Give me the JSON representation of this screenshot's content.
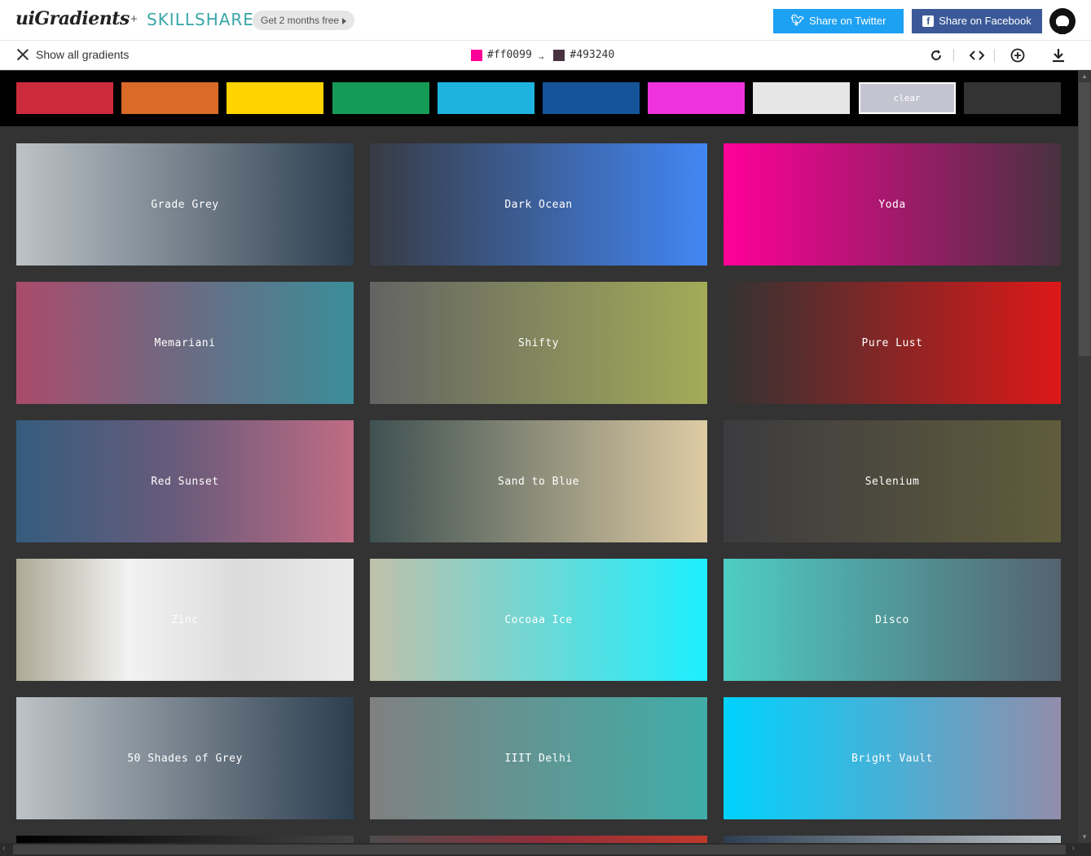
{
  "header": {
    "logo": "uiGradients",
    "plus": "+",
    "partner": "SKILLSHARE",
    "promo": "Get 2 months free",
    "share_twitter": "Share on Twitter",
    "share_facebook": "Share on Facebook",
    "icons": {
      "twitter": "twitter-icon",
      "facebook": "facebook-icon",
      "github": "github-icon"
    }
  },
  "infobar": {
    "close_label": "Show all gradients",
    "color_from": "#ff0099",
    "arrow": "→",
    "color_to": "#493240",
    "tools": [
      "rotate-icon",
      "code-icon",
      "add-icon",
      "download-icon"
    ]
  },
  "filters": [
    {
      "color": "#cc2b3c"
    },
    {
      "color": "#d96a27"
    },
    {
      "color": "#ffd300"
    },
    {
      "color": "#169b56"
    },
    {
      "color": "#1eb3de"
    },
    {
      "color": "#16549a"
    },
    {
      "color": "#ee33dd"
    },
    {
      "color": "#e6e6e6"
    },
    {
      "color": "#c4c4d1",
      "label": "clear"
    },
    {
      "color": "#333333"
    }
  ],
  "gradients": [
    {
      "name": "Grade Grey",
      "from": "#bdc3c7",
      "to": "#2c3e50"
    },
    {
      "name": "Dark Ocean",
      "from": "#373b44",
      "to": "#4286f4"
    },
    {
      "name": "Yoda",
      "from": "#ff0099",
      "to": "#493240"
    },
    {
      "name": "Memariani",
      "from": "#aa4b6b",
      "mid": "#6b6b83",
      "to": "#3b8d99"
    },
    {
      "name": "Shifty",
      "from": "#636363",
      "to": "#a2ab58"
    },
    {
      "name": "Pure Lust",
      "from": "#333333",
      "to": "#dd1818"
    },
    {
      "name": "Red Sunset",
      "from": "#355c7d",
      "mid": "#6c5b7b",
      "to": "#c06c84"
    },
    {
      "name": "Sand to Blue",
      "from": "#3e5151",
      "to": "#decba4"
    },
    {
      "name": "Selenium",
      "from": "#3c3b3f",
      "to": "#605c3c"
    },
    {
      "name": "Zinc",
      "from": "#ada996",
      "mid": "#f2f2f2",
      "mid2": "#dbdbdb",
      "to": "#eaeaea"
    },
    {
      "name": "Cocoaa Ice",
      "from": "#c0c0aa",
      "to": "#1cefff"
    },
    {
      "name": "Disco",
      "from": "#4ecdc4",
      "to": "#556270"
    },
    {
      "name": "50 Shades of Grey",
      "from": "#bdc3c7",
      "to": "#2c3e50"
    },
    {
      "name": "IIIT Delhi",
      "from": "#808080",
      "to": "#3fada8"
    },
    {
      "name": "Bright Vault",
      "from": "#00d2ff",
      "to": "#928dab"
    }
  ],
  "partial_row": [
    {
      "from": "#000000",
      "to": "#434343"
    },
    {
      "from": "#4c4c4c",
      "mid": "#8e2e3a",
      "to": "#c0392b"
    },
    {
      "from": "#2c3e50",
      "to": "#bdc3c7"
    }
  ]
}
